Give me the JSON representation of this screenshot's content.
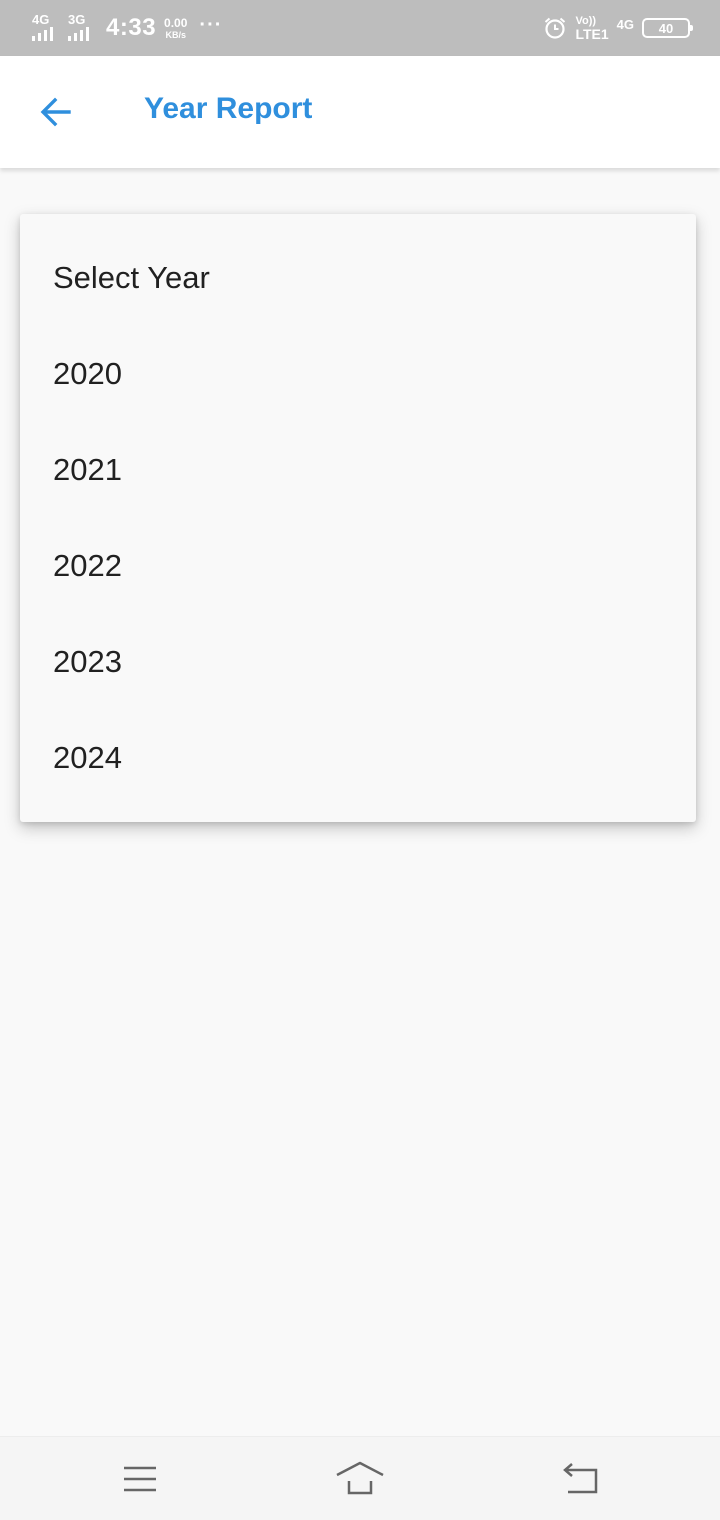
{
  "status_bar": {
    "sim1_network": "4G",
    "sim2_network": "3G",
    "time": "4:33",
    "speed_value": "0.00",
    "speed_unit": "KB/s",
    "more": "···",
    "volte_top": "Vo))",
    "volte_bottom": "LTE1",
    "right_network": "4G",
    "battery_level": "40"
  },
  "app_bar": {
    "title": "Year Report",
    "accent_color": "#2f8fdd"
  },
  "dropdown": {
    "items": [
      {
        "label": "Select Year"
      },
      {
        "label": "2020"
      },
      {
        "label": "2021"
      },
      {
        "label": "2022"
      },
      {
        "label": "2023"
      },
      {
        "label": "2024"
      }
    ]
  },
  "nav_bar": {
    "buttons": [
      "menu-icon",
      "home-icon",
      "back-icon"
    ]
  }
}
